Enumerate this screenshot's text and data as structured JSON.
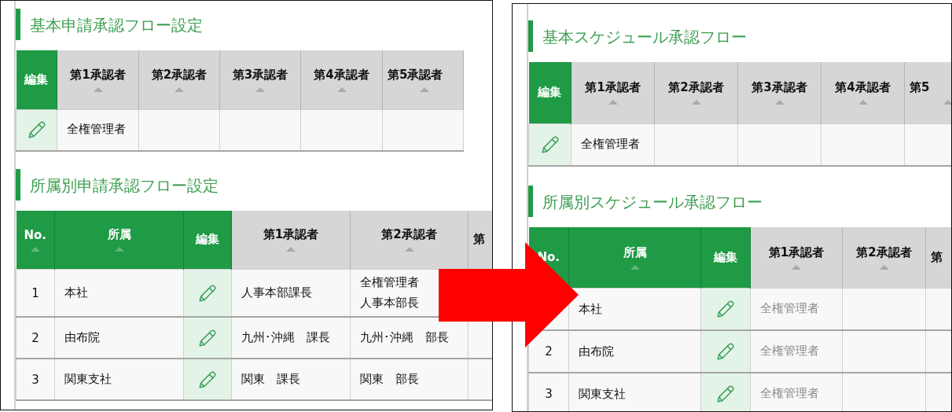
{
  "panels": [
    {
      "basic": {
        "title": "基本申請承認フロー設定",
        "columns": [
          {
            "label": "編集",
            "kind": "edit",
            "sortable": false
          },
          {
            "label": "第1承認者",
            "kind": "approver",
            "sortable": true
          },
          {
            "label": "第2承認者",
            "kind": "approver",
            "sortable": true
          },
          {
            "label": "第3承認者",
            "kind": "approver",
            "sortable": true
          },
          {
            "label": "第4承認者",
            "kind": "approver",
            "sortable": true
          },
          {
            "label": "第5承認者",
            "kind": "approver",
            "sortable": true
          }
        ],
        "rows": [
          {
            "approvers": [
              {
                "lines": [
                  "全権管理者"
                ],
                "muted": false
              }
            ]
          }
        ]
      },
      "department": {
        "title": "所属別申請承認フロー設定",
        "columns": [
          {
            "label": "No.",
            "kind": "number",
            "sortable": true
          },
          {
            "label": "所属",
            "kind": "affiliation",
            "sortable": true
          },
          {
            "label": "編集",
            "kind": "edit",
            "sortable": false
          },
          {
            "label": "第1承認者",
            "kind": "approver",
            "sortable": true
          },
          {
            "label": "第2承認者",
            "kind": "approver",
            "sortable": true
          },
          {
            "label": "第",
            "kind": "approver",
            "sortable": false
          }
        ],
        "rows": [
          {
            "no": "1",
            "name": "本社",
            "approvers": [
              {
                "lines": [
                  "人事本部課長"
                ],
                "muted": false
              },
              {
                "lines": [
                  "全権管理者",
                  "人事本部長"
                ],
                "muted": false
              }
            ]
          },
          {
            "no": "2",
            "name": "由布院",
            "approvers": [
              {
                "lines": [
                  "九州･沖縄　課長"
                ],
                "muted": false
              },
              {
                "lines": [
                  "九州･沖縄　部長"
                ],
                "muted": false
              }
            ]
          },
          {
            "no": "3",
            "name": "関東支社",
            "approvers": [
              {
                "lines": [
                  "関東　課長"
                ],
                "muted": false
              },
              {
                "lines": [
                  "関東　部長"
                ],
                "muted": false
              }
            ]
          }
        ]
      }
    },
    {
      "basic": {
        "title": "基本スケジュール承認フロー",
        "columns": [
          {
            "label": "編集",
            "kind": "edit",
            "sortable": false
          },
          {
            "label": "第1承認者",
            "kind": "approver",
            "sortable": true
          },
          {
            "label": "第2承認者",
            "kind": "approver",
            "sortable": true
          },
          {
            "label": "第3承認者",
            "kind": "approver",
            "sortable": true
          },
          {
            "label": "第4承認者",
            "kind": "approver",
            "sortable": true
          },
          {
            "label": "第5",
            "kind": "approver",
            "sortable": true
          }
        ],
        "rows": [
          {
            "approvers": [
              {
                "lines": [
                  "全権管理者"
                ],
                "muted": false
              }
            ]
          }
        ]
      },
      "department": {
        "title": "所属別スケジュール承認フロー",
        "columns": [
          {
            "label": "No.",
            "kind": "number",
            "sortable": false
          },
          {
            "label": "所属",
            "kind": "affiliation",
            "sortable": true
          },
          {
            "label": "編集",
            "kind": "edit",
            "sortable": false
          },
          {
            "label": "第1承認者",
            "kind": "approver",
            "sortable": true
          },
          {
            "label": "第2承認者",
            "kind": "approver",
            "sortable": true
          },
          {
            "label": "第",
            "kind": "approver",
            "sortable": false
          }
        ],
        "rows": [
          {
            "name": "本社",
            "approvers": [
              {
                "lines": [
                  "全権管理者"
                ],
                "muted": true
              }
            ]
          },
          {
            "no": "2",
            "name": "由布院",
            "approvers": [
              {
                "lines": [
                  "全権管理者"
                ],
                "muted": true
              }
            ]
          },
          {
            "no": "3",
            "name": "関東支社",
            "approvers": [
              {
                "lines": [
                  "全権管理者"
                ],
                "muted": true
              }
            ]
          }
        ]
      }
    }
  ]
}
